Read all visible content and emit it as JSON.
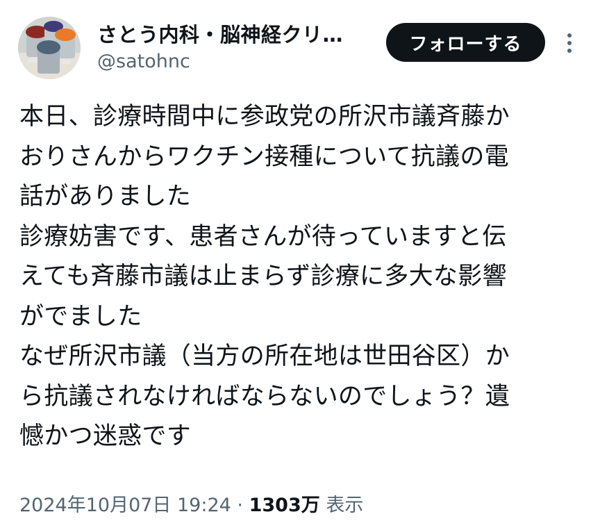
{
  "author": {
    "display_name": "さとう内科・脳神経クリ…",
    "handle": "@satohnc",
    "avatar_icon": "avatar-image"
  },
  "follow_button": {
    "label": "フォローする"
  },
  "more_icon": "more-options-icon",
  "tweet": {
    "lines": [
      "本日、診療時間中に参政党の所沢市議斉藤か",
      "おりさんからワクチン接種について抗議の電",
      "話がありました",
      "診療妨害です、患者さんが待っていますと伝",
      "えても斉藤市議は止まらず診療に多大な影響",
      "がでました",
      "なぜ所沢市議（当方の所在地は世田谷区）か",
      "ら抗議されなければならないのでしょう？遺",
      "憾かつ迷惑です"
    ]
  },
  "meta": {
    "timestamp": "2024年10月07日 19:24",
    "separator": " · ",
    "views_count": "1303万",
    "views_label": " 表示"
  },
  "colors": {
    "text_primary": "#0f1419",
    "text_secondary": "#536471",
    "button_bg": "#0f1419",
    "button_text": "#ffffff"
  }
}
